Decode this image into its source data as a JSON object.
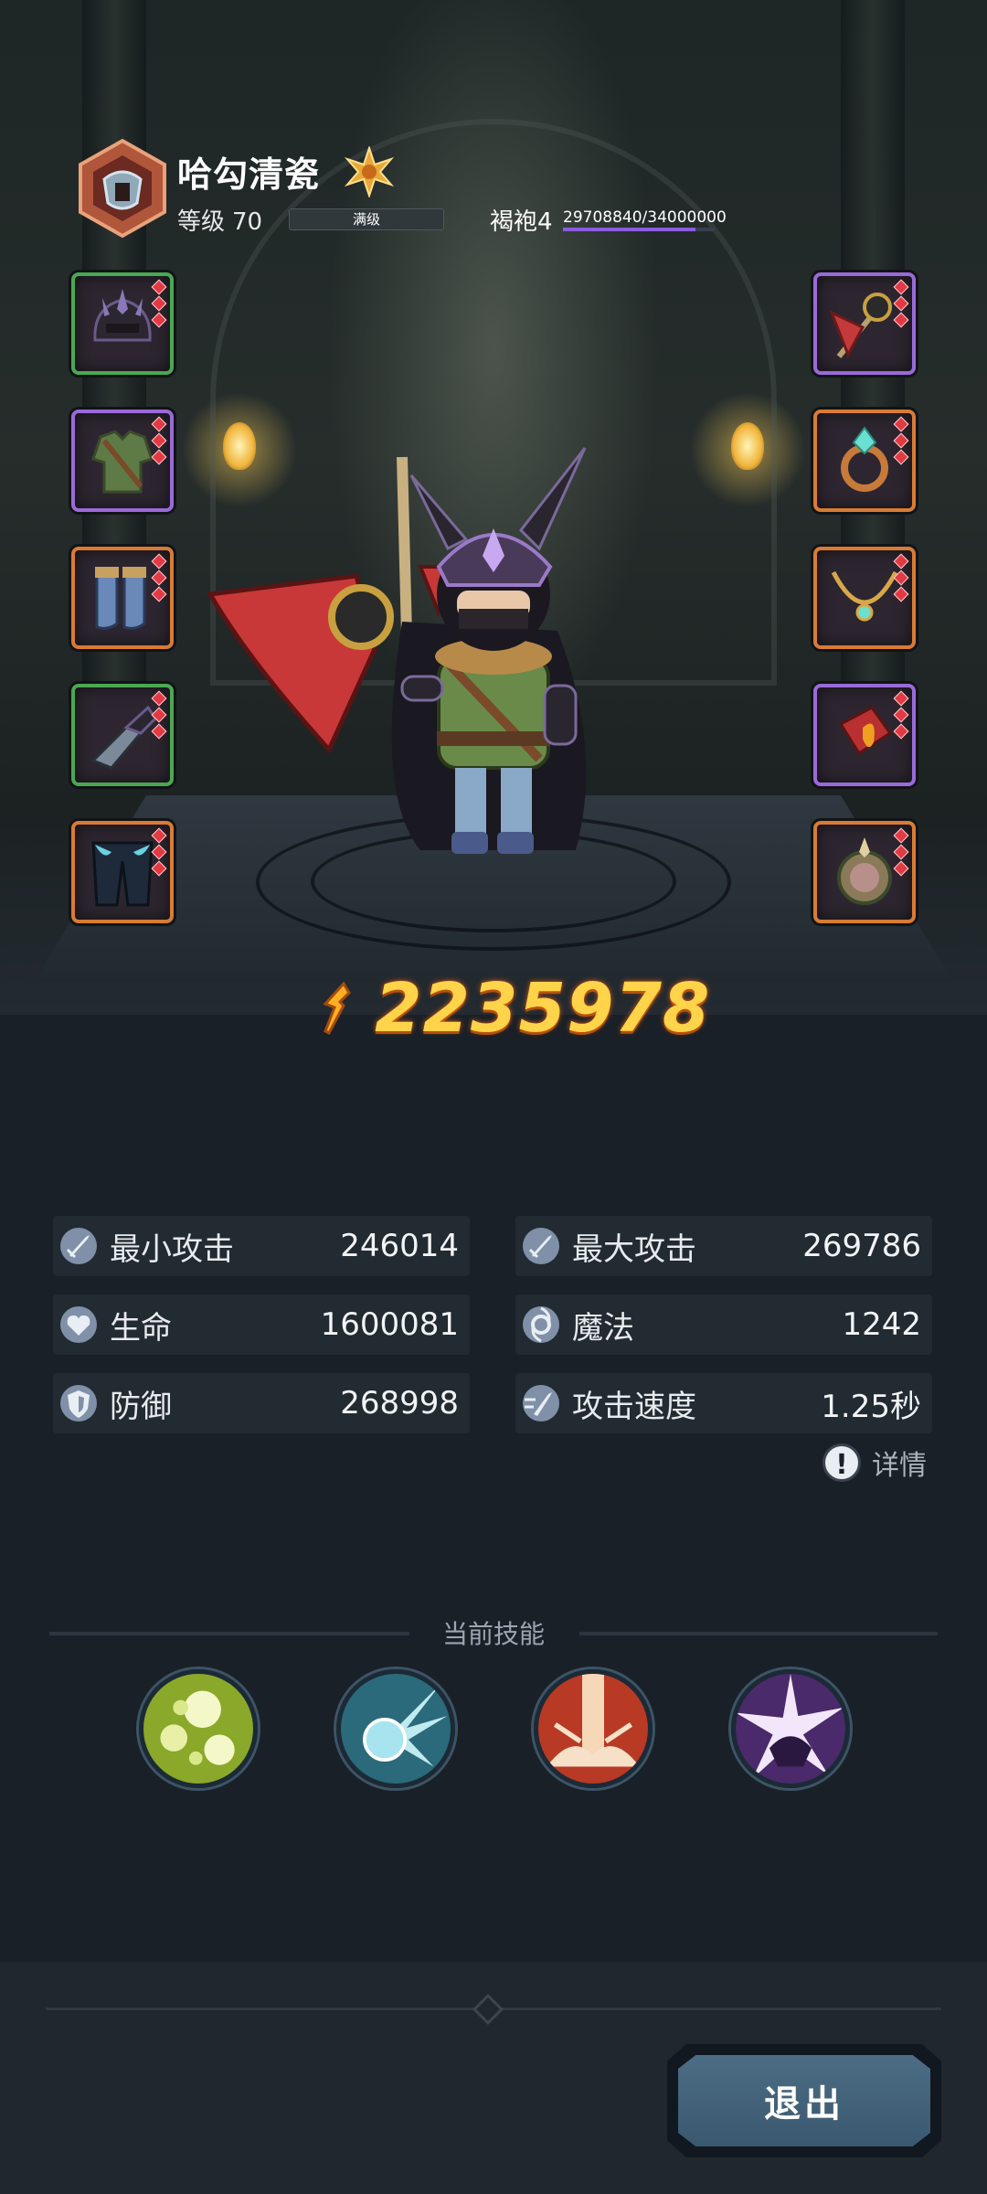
{
  "header": {
    "player_name": "哈勾清瓷",
    "level_label": "等级",
    "level_value": "70",
    "level_bar_text": "满级",
    "class_name": "褐袍4",
    "exp_text": "29708840/34000000",
    "exp_progress": 0.8738
  },
  "equipment": {
    "left": [
      {
        "icon": "helmet-icon",
        "rarity": "green"
      },
      {
        "icon": "armor-icon",
        "rarity": "purple"
      },
      {
        "icon": "boots-icon",
        "rarity": "orange"
      },
      {
        "icon": "gloves-icon",
        "rarity": "green"
      },
      {
        "icon": "pants-icon",
        "rarity": "orange"
      }
    ],
    "right": [
      {
        "icon": "axe-icon",
        "rarity": "purple"
      },
      {
        "icon": "ring-icon",
        "rarity": "orange"
      },
      {
        "icon": "necklace-icon",
        "rarity": "orange"
      },
      {
        "icon": "bracer-icon",
        "rarity": "purple"
      },
      {
        "icon": "charm-icon",
        "rarity": "orange"
      }
    ]
  },
  "power": {
    "value": "2235978"
  },
  "stats": [
    {
      "label": "最小攻击",
      "value": "246014",
      "icon": "sword-icon"
    },
    {
      "label": "最大攻击",
      "value": "269786",
      "icon": "sword-icon"
    },
    {
      "label": "生命",
      "value": "1600081",
      "icon": "heart-icon"
    },
    {
      "label": "魔法",
      "value": "1242",
      "icon": "magic-icon"
    },
    {
      "label": "防御",
      "value": "268998",
      "icon": "shield-icon"
    },
    {
      "label": "攻击速度",
      "value": "1.25秒",
      "icon": "speed-icon"
    }
  ],
  "detail_label": "详情",
  "skills": {
    "title": "当前技能",
    "items": [
      {
        "icon": "poison-orbs-skill-icon"
      },
      {
        "icon": "frost-burst-skill-icon"
      },
      {
        "icon": "fire-pillar-skill-icon"
      },
      {
        "icon": "shadow-blast-skill-icon"
      }
    ]
  },
  "footer": {
    "exit_label": "退出"
  },
  "colors": {
    "background": "#1a2027",
    "power": "#ffd34a",
    "rarity_orange": "#d97b34",
    "rarity_green": "#4aa852",
    "rarity_purple": "#9a6ad8",
    "exp_bar": "#8a5ce0"
  }
}
